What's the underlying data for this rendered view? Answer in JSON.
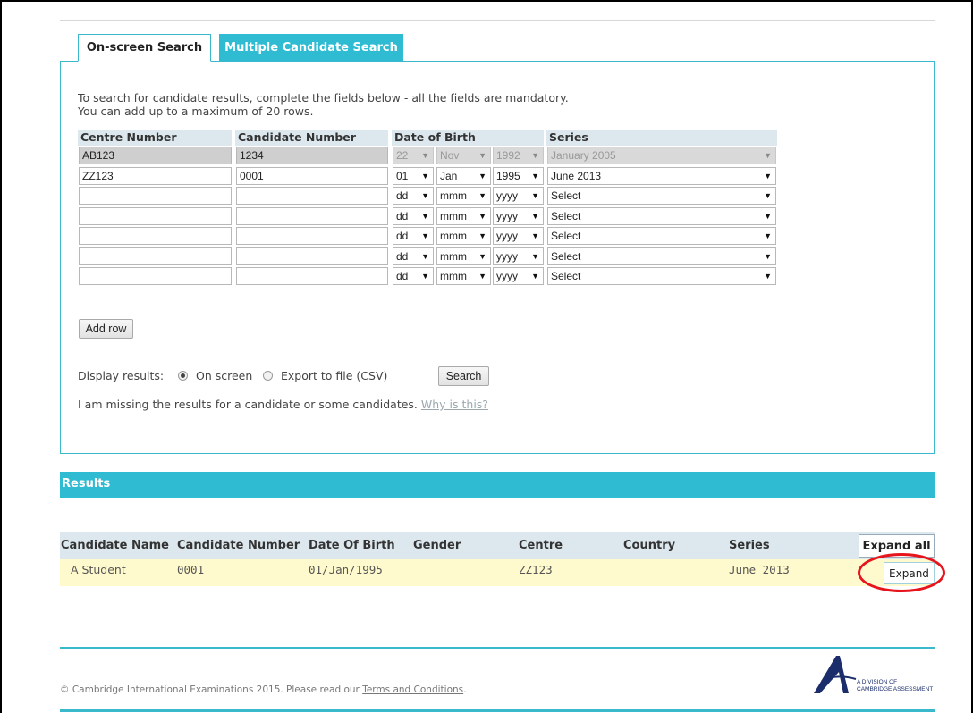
{
  "tabs": [
    {
      "label": "On-screen Search",
      "active": true
    },
    {
      "label": "Multiple Candidate Search",
      "active": false
    }
  ],
  "intro": {
    "line1": "To search for candidate results, complete the fields below - all the fields are mandatory.",
    "line2": "You can add up to a maximum of 20 rows."
  },
  "grid": {
    "headers": {
      "centre": "Centre Number",
      "candidate": "Candidate Number",
      "dob": "Date of Birth",
      "series": "Series"
    },
    "rows": [
      {
        "centre": "AB123",
        "candidate": "1234",
        "day": "22",
        "month": "Nov",
        "year": "1992",
        "series": "January 2005",
        "disabled": true
      },
      {
        "centre": "ZZ123",
        "candidate": "0001",
        "day": "01",
        "month": "Jan",
        "year": "1995",
        "series": "June 2013"
      },
      {
        "centre": "",
        "candidate": "",
        "day": "dd",
        "month": "mmm",
        "year": "yyyy",
        "series": "Select"
      },
      {
        "centre": "",
        "candidate": "",
        "day": "dd",
        "month": "mmm",
        "year": "yyyy",
        "series": "Select"
      },
      {
        "centre": "",
        "candidate": "",
        "day": "dd",
        "month": "mmm",
        "year": "yyyy",
        "series": "Select"
      },
      {
        "centre": "",
        "candidate": "",
        "day": "dd",
        "month": "mmm",
        "year": "yyyy",
        "series": "Select"
      },
      {
        "centre": "",
        "candidate": "",
        "day": "dd",
        "month": "mmm",
        "year": "yyyy",
        "series": "Select"
      }
    ]
  },
  "add_row_label": "Add row",
  "display": {
    "label": "Display results:",
    "on_screen": "On screen",
    "export": "Export to file (CSV)",
    "selected": "On screen",
    "search_label": "Search"
  },
  "missing": {
    "text": "I am missing the results for a candidate or some candidates.",
    "link": "Why is this?"
  },
  "results": {
    "title": "Results",
    "columns": {
      "name": "Candidate Name",
      "number": "Candidate Number",
      "dob": "Date Of Birth",
      "gender": "Gender",
      "centre": "Centre",
      "country": "Country",
      "series": "Series"
    },
    "expand_all_label": "Expand all",
    "rows": [
      {
        "name": "A Student",
        "number": "0001",
        "dob": "01/Jan/1995",
        "gender": "",
        "centre": "ZZ123",
        "country": "",
        "series": "June 2013",
        "expand_label": "Expand"
      }
    ]
  },
  "footer": {
    "copyright_prefix": "© Cambridge International Examinations 2015. Please read our",
    "terms_link": "Terms and Conditions",
    "copyright_suffix": ".",
    "logo_line1": "A DIVISION OF",
    "logo_line2": "CAMBRIDGE ASSESSMENT"
  },
  "colors": {
    "accent": "#2fbcd3",
    "highlight": "#fffacd",
    "annotation": "#e8141c"
  }
}
